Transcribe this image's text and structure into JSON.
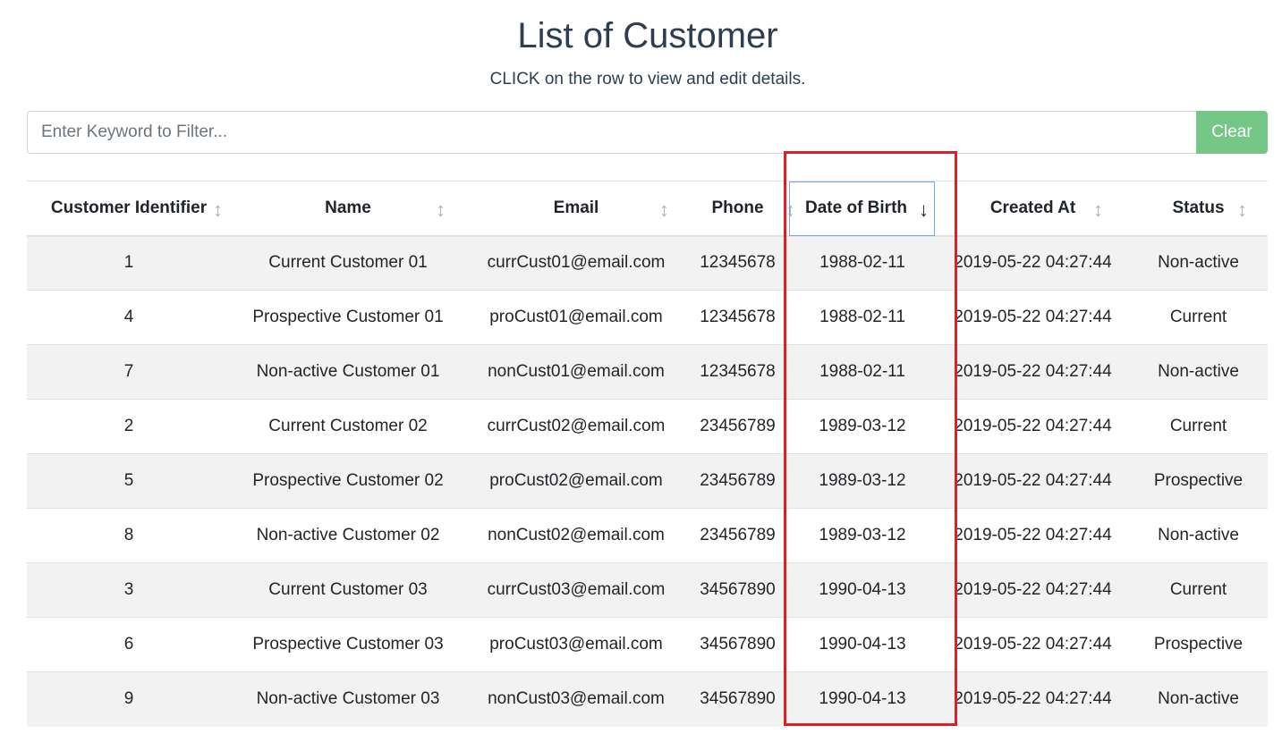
{
  "page": {
    "title": "List of Customer",
    "subtitle": "CLICK on the row to view and edit details."
  },
  "filter": {
    "placeholder": "Enter Keyword to Filter...",
    "value": "",
    "clear_label": "Clear"
  },
  "colors": {
    "clear_button": "#75c785",
    "highlight_border": "#e01e26",
    "active_header_border": "#7ba7e6",
    "striped_row": "#f2f2f2"
  },
  "table": {
    "headers": [
      {
        "label": "Customer Identifier",
        "sort_icon": "sort-both-icon",
        "glyph": "↕"
      },
      {
        "label": "Name",
        "sort_icon": "sort-both-icon",
        "glyph": "↕"
      },
      {
        "label": "Email",
        "sort_icon": "sort-both-icon",
        "glyph": "↕"
      },
      {
        "label": "Phone",
        "sort_icon": "sort-both-icon",
        "glyph": "↕"
      },
      {
        "label": "Date of Birth",
        "sort_icon": "sort-desc-icon",
        "glyph": "↓",
        "active": true
      },
      {
        "label": "Created At",
        "sort_icon": "sort-both-icon",
        "glyph": "↕"
      },
      {
        "label": "Status",
        "sort_icon": "sort-both-icon",
        "glyph": "↕"
      }
    ],
    "rows": [
      [
        "1",
        "Current Customer 01",
        "currCust01@email.com",
        "12345678",
        "1988-02-11",
        "2019-05-22 04:27:44",
        "Non-active"
      ],
      [
        "4",
        "Prospective Customer 01",
        "proCust01@email.com",
        "12345678",
        "1988-02-11",
        "2019-05-22 04:27:44",
        "Current"
      ],
      [
        "7",
        "Non-active Customer 01",
        "nonCust01@email.com",
        "12345678",
        "1988-02-11",
        "2019-05-22 04:27:44",
        "Non-active"
      ],
      [
        "2",
        "Current Customer 02",
        "currCust02@email.com",
        "23456789",
        "1989-03-12",
        "2019-05-22 04:27:44",
        "Current"
      ],
      [
        "5",
        "Prospective Customer 02",
        "proCust02@email.com",
        "23456789",
        "1989-03-12",
        "2019-05-22 04:27:44",
        "Prospective"
      ],
      [
        "8",
        "Non-active Customer 02",
        "nonCust02@email.com",
        "23456789",
        "1989-03-12",
        "2019-05-22 04:27:44",
        "Non-active"
      ],
      [
        "3",
        "Current Customer 03",
        "currCust03@email.com",
        "34567890",
        "1990-04-13",
        "2019-05-22 04:27:44",
        "Current"
      ],
      [
        "6",
        "Prospective Customer 03",
        "proCust03@email.com",
        "34567890",
        "1990-04-13",
        "2019-05-22 04:27:44",
        "Prospective"
      ],
      [
        "9",
        "Non-active Customer 03",
        "nonCust03@email.com",
        "34567890",
        "1990-04-13",
        "2019-05-22 04:27:44",
        "Non-active"
      ]
    ]
  }
}
